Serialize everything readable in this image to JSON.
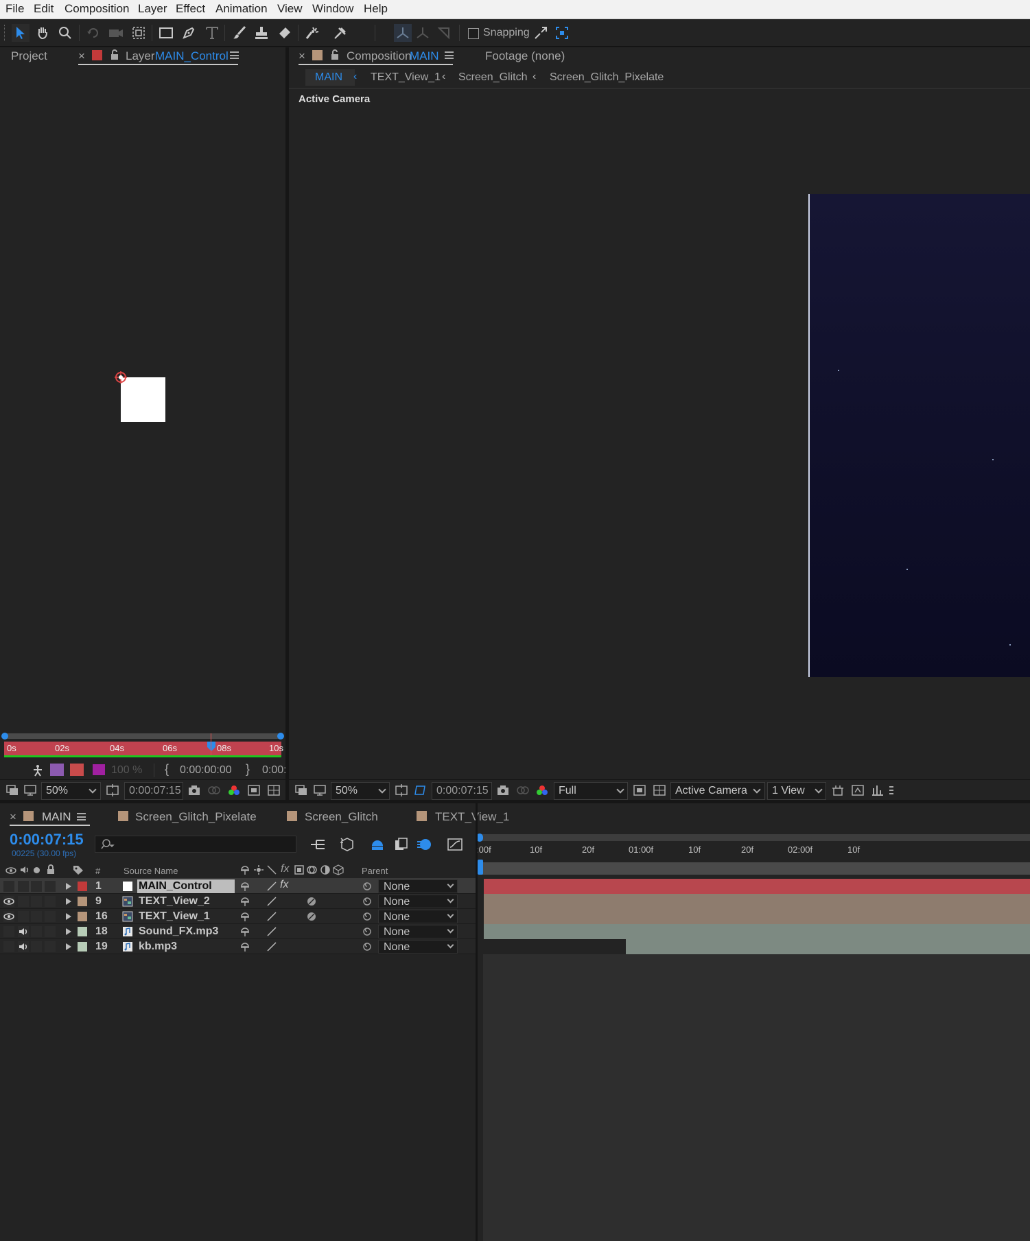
{
  "menu": [
    "File",
    "Edit",
    "Composition",
    "Layer",
    "Effect",
    "Animation",
    "View",
    "Window",
    "Help"
  ],
  "toolbar": {
    "snapping_label": "Snapping"
  },
  "layer_panel": {
    "project_tab": "Project",
    "close": "×",
    "layer_prefix": "Layer",
    "layer_name": "MAIN_Control",
    "ruler_labels": [
      "0s",
      "02s",
      "04s",
      "06s",
      "08s",
      "10s"
    ],
    "opacity": "100 %",
    "in_time": "0:00:00:00",
    "out_time": "0:00:",
    "zoom": "50%",
    "timecode": "0:00:07:15"
  },
  "comp_panel": {
    "close": "×",
    "comp_prefix": "Composition",
    "comp_name": "MAIN",
    "footage_tab": "Footage (none)",
    "breadcrumbs": [
      "MAIN",
      "TEXT_View_1",
      "Screen_Glitch",
      "Screen_Glitch_Pixelate"
    ],
    "active_camera_label": "Active Camera",
    "zoom": "50%",
    "timecode": "0:00:07:15",
    "resolution": "Full",
    "camera": "Active Camera",
    "views": "1 View"
  },
  "timeline": {
    "tabs": [
      "MAIN",
      "Screen_Glitch_Pixelate",
      "Screen_Glitch",
      "TEXT_View_1"
    ],
    "timecode": "0:00:07:15",
    "frame_info": "00225 (30.00 fps)",
    "columns": {
      "num": "#",
      "source_name": "Source Name",
      "parent": "Parent"
    },
    "ruler": [
      ":00f",
      "10f",
      "20f",
      "01:00f",
      "10f",
      "20f",
      "02:00f",
      "10f"
    ],
    "layers": [
      {
        "num": "1",
        "name": "MAIN_Control",
        "parent": "None",
        "label_color": "#c23a3a",
        "bar_color": "#b8474e",
        "selected": true,
        "visible": false,
        "audio": false,
        "fx": true
      },
      {
        "num": "9",
        "name": "TEXT_View_2",
        "parent": "None",
        "label_color": "#b5957a",
        "bar_color": "#8e7c6e",
        "selected": false,
        "visible": true,
        "audio": false,
        "fx": false
      },
      {
        "num": "16",
        "name": "TEXT_View_1",
        "parent": "None",
        "label_color": "#b5957a",
        "bar_color": "#8e7c6e",
        "selected": false,
        "visible": true,
        "audio": false,
        "fx": false
      },
      {
        "num": "18",
        "name": "Sound_FX.mp3",
        "parent": "None",
        "label_color": "#b7ccb7",
        "bar_color": "#7d8a82",
        "selected": false,
        "visible": false,
        "audio": true,
        "fx": false
      },
      {
        "num": "19",
        "name": "kb.mp3",
        "parent": "None",
        "label_color": "#b7ccb7",
        "bar_color": "#7d8a82",
        "selected": false,
        "visible": false,
        "audio": true,
        "fx": false
      }
    ]
  }
}
